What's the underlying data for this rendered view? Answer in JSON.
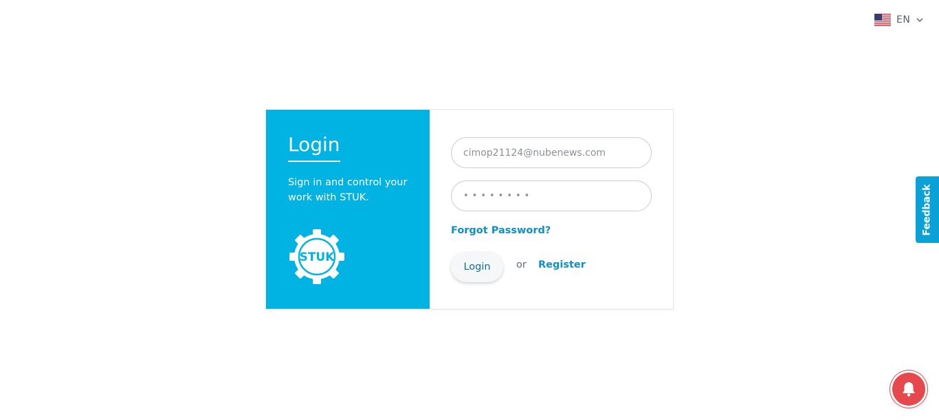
{
  "language": {
    "code": "EN",
    "flag_icon": "us-flag-icon",
    "dropdown_icon": "chevron-down-icon"
  },
  "login_panel": {
    "title": "Login",
    "subtitle": "Sign in and control your work with STUK.",
    "logo_text": "STUK",
    "accent_color": "#00b3e3"
  },
  "form": {
    "email_value": "cimop21124@nubenews.com",
    "password_value": "••••••••",
    "forgot_password_label": "Forgot Password?",
    "login_button_label": "Login",
    "or_text": "or",
    "register_label": "Register"
  },
  "feedback_tab": {
    "label": "Feedback",
    "color": "#0aa2d6"
  },
  "notification": {
    "icon": "bell-icon",
    "color": "#e5484d"
  }
}
